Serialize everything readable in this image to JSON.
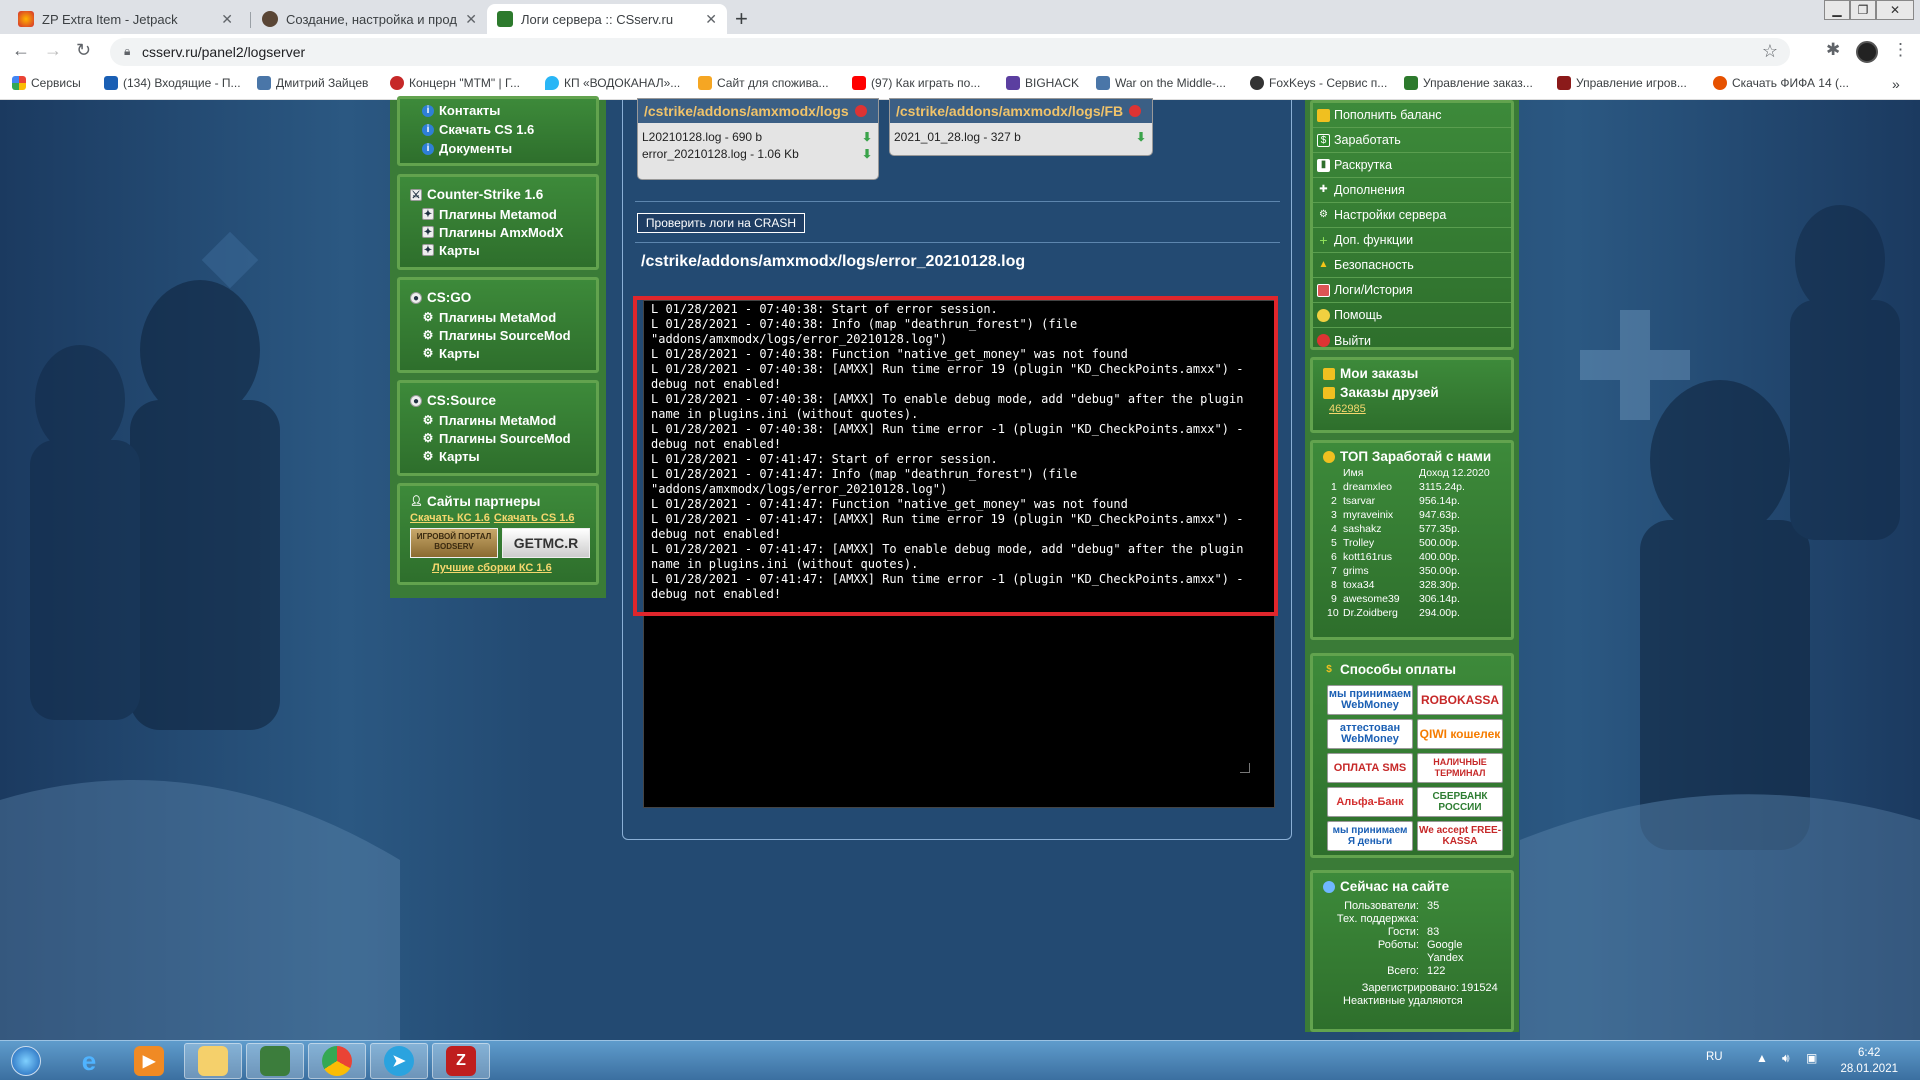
{
  "browser": {
    "tabs": [
      {
        "label": "ZP Extra Item - Jetpack",
        "active": false
      },
      {
        "label": "Создание, настройка и продвиж",
        "active": false
      },
      {
        "label": "Логи сервера :: CSserv.ru",
        "active": true
      }
    ],
    "url": "csserv.ru/panel2/logserver",
    "bookmarks": [
      "Сервисы",
      "(134) Входящие - П...",
      "Дмитрий Зайцев",
      "Концерн \"МТМ\" | Г...",
      "КП «ВОДОКАНАЛ»...",
      "Сайт для спожива...",
      "(97) Как играть по...",
      "BIGHACK",
      "War on the Middle-...",
      "FoxKeys - Сервис п...",
      "Управление заказ...",
      "Управление игров...",
      "Скачать ФИФА 14 (..."
    ]
  },
  "left": {
    "top_links": [
      "Контакты",
      "Скачать CS 1.6",
      "Документы"
    ],
    "cs16": {
      "title": "Counter-Strike 1.6",
      "items": [
        "Плагины Metamod",
        "Плагины AmxModX",
        "Карты"
      ]
    },
    "csgo": {
      "title": "CS:GO",
      "items": [
        "Плагины MetaMod",
        "Плагины SourceMod",
        "Карты"
      ]
    },
    "css": {
      "title": "CS:Source",
      "items": [
        "Плагины MetaMod",
        "Плагины SourceMod",
        "Карты"
      ]
    },
    "partners": {
      "title": "Сайты партнеры",
      "link1": "Скачать КС 1.6",
      "link2": "Скачать CS 1.6",
      "banner1": "ИГРОВОЙ ПОРТАЛ BODSERV",
      "banner2": "GETMC.R",
      "bottom": "Лучшие сборки КС 1.6"
    }
  },
  "center": {
    "box1": {
      "path": "/cstrike/addons/amxmodx/logs",
      "files": [
        {
          "name": "L20210128.log - 690 b"
        },
        {
          "name": "error_20210128.log - 1.06 Kb"
        }
      ]
    },
    "box2": {
      "path": "/cstrike/addons/amxmodx/logs/FB",
      "files": [
        {
          "name": "2021_01_28.log - 327 b"
        }
      ]
    },
    "crash_button": "Проверить логи на CRASH",
    "log_title": "/cstrike/addons/amxmodx/logs/error_20210128.log",
    "log_text": "L 01/28/2021 - 07:40:38: Start of error session.\nL 01/28/2021 - 07:40:38: Info (map \"deathrun_forest\") (file\n\"addons/amxmodx/logs/error_20210128.log\")\nL 01/28/2021 - 07:40:38: Function \"native_get_money\" was not found\nL 01/28/2021 - 07:40:38: [AMXX] Run time error 19 (plugin \"KD_CheckPoints.amxx\") -\ndebug not enabled!\nL 01/28/2021 - 07:40:38: [AMXX] To enable debug mode, add \"debug\" after the plugin\nname in plugins.ini (without quotes).\nL 01/28/2021 - 07:40:38: [AMXX] Run time error -1 (plugin \"KD_CheckPoints.amxx\") -\ndebug not enabled!\nL 01/28/2021 - 07:41:47: Start of error session.\nL 01/28/2021 - 07:41:47: Info (map \"deathrun_forest\") (file\n\"addons/amxmodx/logs/error_20210128.log\")\nL 01/28/2021 - 07:41:47: Function \"native_get_money\" was not found\nL 01/28/2021 - 07:41:47: [AMXX] Run time error 19 (plugin \"KD_CheckPoints.amxx\") -\ndebug not enabled!\nL 01/28/2021 - 07:41:47: [AMXX] To enable debug mode, add \"debug\" after the plugin\nname in plugins.ini (without quotes).\nL 01/28/2021 - 07:41:47: [AMXX] Run time error -1 (plugin \"KD_CheckPoints.amxx\") -\ndebug not enabled!"
  },
  "right": {
    "menu": [
      "Пополнить баланс",
      "Заработать",
      "Раскрутка",
      "Дополнения",
      "Настройки сервера",
      "Доп. функции",
      "Безопасность",
      "Логи/История",
      "Помощь",
      "Выйти"
    ],
    "orders": {
      "my": "Мои заказы",
      "friends": "Заказы друзей",
      "id": "462985"
    },
    "top": {
      "title": "ТОП Заработай с нами",
      "col_name": "Имя",
      "col_income": "Доход 12.2020",
      "rows": [
        {
          "n": "1",
          "name": "dreamxleo",
          "income": "3115.24р."
        },
        {
          "n": "2",
          "name": "tsarvar",
          "income": "956.14р."
        },
        {
          "n": "3",
          "name": "myraveinix",
          "income": "947.63р."
        },
        {
          "n": "4",
          "name": "sashakz",
          "income": "577.35р."
        },
        {
          "n": "5",
          "name": "Trolley",
          "income": "500.00р."
        },
        {
          "n": "6",
          "name": "kott161rus",
          "income": "400.00р."
        },
        {
          "n": "7",
          "name": "grims",
          "income": "350.00р."
        },
        {
          "n": "8",
          "name": "toxa34",
          "income": "328.30р."
        },
        {
          "n": "9",
          "name": "awesome39",
          "income": "306.14р."
        },
        {
          "n": "10",
          "name": "Dr.Zoidberg",
          "income": "294.00р."
        }
      ]
    },
    "payments": {
      "title": "Способы оплаты",
      "items": [
        "мы принимаем WebMoney",
        "ROBOKASSA",
        "аттестован WebMoney",
        "QIWI кошелек",
        "ОПЛАТА SMS",
        "НАЛИЧНЫЕ ТЕРМИНАЛ",
        "Альфа-Банк",
        "СБЕРБАНК РОССИИ",
        "мы принимаем Я деньги",
        "We accept FREE-KASSA"
      ]
    },
    "online": {
      "title": "Сейчас на сайте",
      "users_label": "Пользователи:",
      "users": "35",
      "support_label": "Тех. поддержка:",
      "support": "",
      "guests_label": "Гости:",
      "guests": "83",
      "robots_label": "Роботы:",
      "robots1": "Google",
      "robots2": "Yandex",
      "total_label": "Всего:",
      "total": "122",
      "registered_label": "Зарегистрировано:",
      "registered": "191524",
      "inactive": "Неактивные удаляются"
    }
  },
  "taskbar": {
    "lang": "RU",
    "time": "6:42",
    "date": "28.01.2021"
  },
  "colors": {
    "accent_green": "#3d8a3a",
    "log_path": "#f0c36a",
    "highlight": "#e0262c"
  }
}
